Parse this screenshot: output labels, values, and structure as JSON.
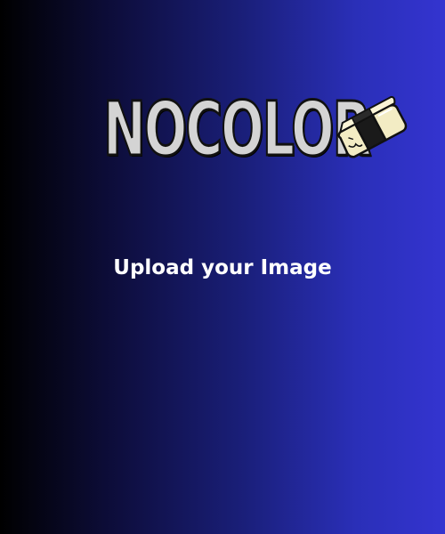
{
  "brand": {
    "name": "NOCOLOR",
    "icon": "eraser-icon"
  },
  "upload": {
    "label": "Upload your Image"
  },
  "colors": {
    "gradient_start": "#000000",
    "gradient_end": "#3434d0",
    "logo_fill": "#d4d4d4",
    "logo_outline": "#111111",
    "text": "#ffffff"
  }
}
